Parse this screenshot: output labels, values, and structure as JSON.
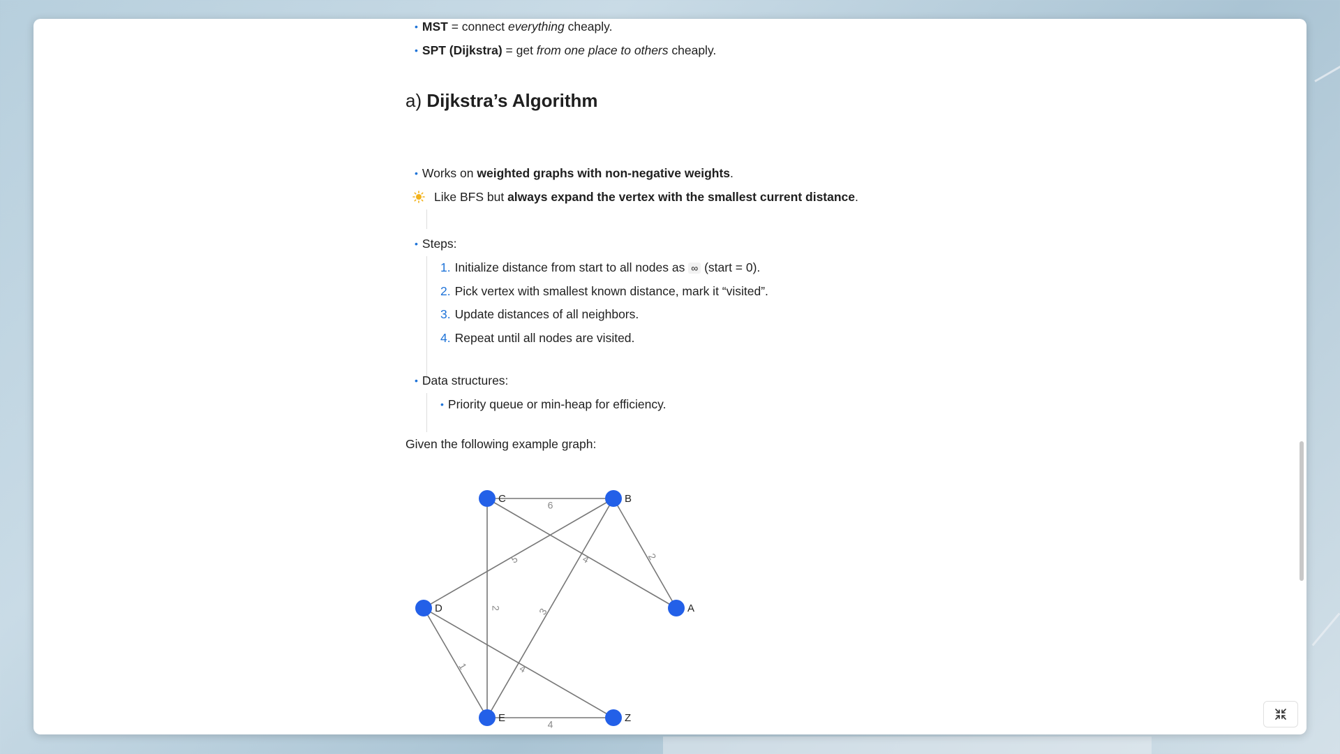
{
  "intro_bullets": [
    {
      "bold": "MST",
      "text_a": " = connect ",
      "italic": "everything",
      "text_b": " cheaply."
    },
    {
      "bold": "SPT (Dijkstra)",
      "text_a": " = get ",
      "italic": "from one place to others",
      "text_b": " cheaply."
    }
  ],
  "section": {
    "prefix": "a)",
    "title": "Dijkstra’s Algorithm"
  },
  "works_on": {
    "text": "Works on ",
    "bold": "weighted graphs with non-negative weights",
    "end": "."
  },
  "tip": {
    "text": "Like BFS but ",
    "bold": "always expand the vertex with the smallest current distance",
    "end": ".",
    "icon": "lightbulb-icon"
  },
  "steps_label": "Steps:",
  "steps": [
    {
      "num": "1.",
      "pre": "Initialize distance from start to all nodes as ",
      "code": "∞",
      "post": " (start = 0)."
    },
    {
      "num": "2.",
      "text": "Pick vertex with smallest known distance, mark it “visited”."
    },
    {
      "num": "3.",
      "text": "Update distances of all neighbors."
    },
    {
      "num": "4.",
      "text": "Repeat until all nodes are visited."
    }
  ],
  "ds_label": "Data structures:",
  "ds_items": [
    "Priority queue or min-heap for efficiency."
  ],
  "graph_intro": "Given the following example graph:",
  "graph": {
    "node_color": "#2360e8",
    "edge_color": "#777777",
    "nodes": [
      "C",
      "B",
      "D",
      "A",
      "E",
      "Z"
    ],
    "edges": [
      {
        "from": "C",
        "to": "B",
        "weight": "6"
      },
      {
        "from": "C",
        "to": "A",
        "weight": "4"
      },
      {
        "from": "C",
        "to": "E",
        "weight": "2"
      },
      {
        "from": "B",
        "to": "D",
        "weight": "5"
      },
      {
        "from": "B",
        "to": "A",
        "weight": "2"
      },
      {
        "from": "B",
        "to": "E",
        "weight": "3"
      },
      {
        "from": "D",
        "to": "E",
        "weight": "1"
      },
      {
        "from": "D",
        "to": "Z",
        "weight": "4"
      },
      {
        "from": "E",
        "to": "Z",
        "weight": "4"
      }
    ]
  },
  "exit_icon": "collapse-icon"
}
